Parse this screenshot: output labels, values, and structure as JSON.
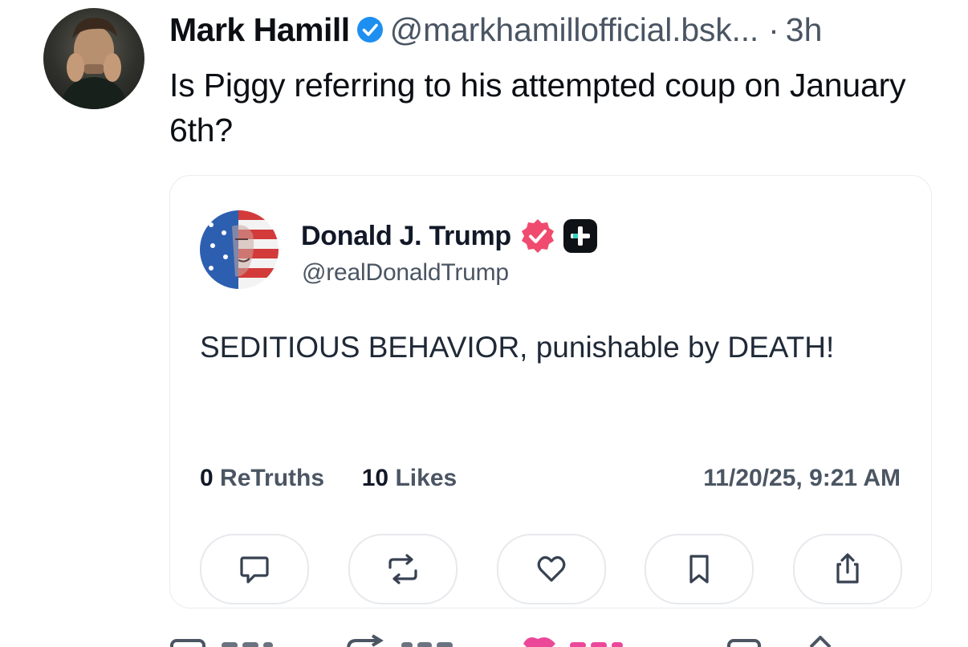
{
  "post": {
    "author_name": "Mark Hamill",
    "handle": "@markhamillofficial.bsk...",
    "separator": "·",
    "time": "3h",
    "text": "Is Piggy referring to his attempted coup on January 6th?",
    "verified_color": "#1d8ff0"
  },
  "embed": {
    "author_name": "Donald J. Trump",
    "handle": "@realDonaldTrump",
    "text": "SEDITIOUS BEHAVIOR, punishable by DEATH!",
    "stats": {
      "retruths_count": "0",
      "retruths_label": "ReTruths",
      "likes_count": "10",
      "likes_label": "Likes"
    },
    "date": "11/20/25, 9:21 AM",
    "verified_color": "#f04b6e",
    "actions": [
      {
        "icon": "reply-icon"
      },
      {
        "icon": "retruth-icon"
      },
      {
        "icon": "heart-icon"
      },
      {
        "icon": "bookmark-icon"
      },
      {
        "icon": "share-icon"
      }
    ]
  },
  "footer_actions": [
    {
      "icon": "reply-icon"
    },
    {
      "icon": "repost-icon"
    },
    {
      "icon": "like-icon",
      "color": "#ec4899"
    },
    {
      "icon": "more-icon"
    },
    {
      "icon": "share-icon"
    }
  ]
}
